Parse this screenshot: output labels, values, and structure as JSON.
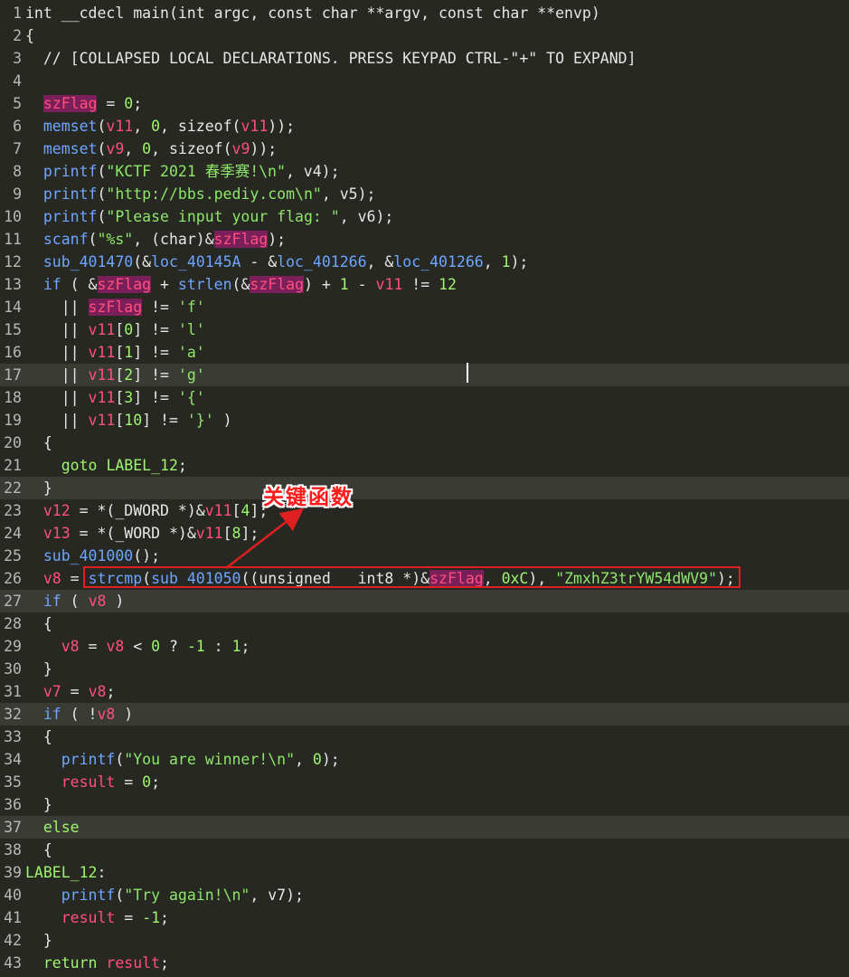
{
  "editor": {
    "lines": [
      {
        "n": "1",
        "tokens": [
          [
            "int __cdecl main(int argc, const char **argv, const char **envp)",
            ""
          ]
        ]
      },
      {
        "n": "2",
        "tokens": [
          [
            "{",
            ""
          ]
        ]
      },
      {
        "n": "3",
        "tokens": [
          [
            "  // [COLLAPSED LOCAL DECLARATIONS. PRESS KEYPAD CTRL-\"+\" TO EXPAND]",
            "cm"
          ]
        ]
      },
      {
        "n": "4",
        "tokens": []
      },
      {
        "n": "5",
        "tokens": [
          [
            "  ",
            ""
          ],
          [
            "szFlag",
            "hv"
          ],
          [
            " = ",
            ""
          ],
          [
            "0",
            "num"
          ],
          [
            ";",
            ""
          ]
        ]
      },
      {
        "n": "6",
        "tokens": [
          [
            "  ",
            ""
          ],
          [
            "memset",
            "fn"
          ],
          [
            "(",
            ""
          ],
          [
            "v11",
            "var"
          ],
          [
            ", ",
            ""
          ],
          [
            "0",
            "num"
          ],
          [
            ", sizeof(",
            ""
          ],
          [
            "v11",
            "var"
          ],
          [
            "));",
            ""
          ]
        ]
      },
      {
        "n": "7",
        "tokens": [
          [
            "  ",
            ""
          ],
          [
            "memset",
            "fn"
          ],
          [
            "(",
            ""
          ],
          [
            "v9",
            "var"
          ],
          [
            ", ",
            ""
          ],
          [
            "0",
            "num"
          ],
          [
            ", sizeof(",
            ""
          ],
          [
            "v9",
            "var"
          ],
          [
            "));",
            ""
          ]
        ]
      },
      {
        "n": "8",
        "tokens": [
          [
            "  ",
            ""
          ],
          [
            "printf",
            "fn"
          ],
          [
            "(",
            ""
          ],
          [
            "\"KCTF 2021 春季赛!\\n\"",
            "str"
          ],
          [
            ", v4);",
            ""
          ]
        ]
      },
      {
        "n": "9",
        "tokens": [
          [
            "  ",
            ""
          ],
          [
            "printf",
            "fn"
          ],
          [
            "(",
            ""
          ],
          [
            "\"http://bbs.pediy.com\\n\"",
            "str"
          ],
          [
            ", v5);",
            ""
          ]
        ]
      },
      {
        "n": "10",
        "tokens": [
          [
            "  ",
            ""
          ],
          [
            "printf",
            "fn"
          ],
          [
            "(",
            ""
          ],
          [
            "\"Please input your flag: \"",
            "str"
          ],
          [
            ", v6);",
            ""
          ]
        ]
      },
      {
        "n": "11",
        "tokens": [
          [
            "  ",
            ""
          ],
          [
            "scanf",
            "fn"
          ],
          [
            "(",
            ""
          ],
          [
            "\"%s\"",
            "str"
          ],
          [
            ", (char)&",
            ""
          ],
          [
            "szFlag",
            "hv"
          ],
          [
            ");",
            ""
          ]
        ]
      },
      {
        "n": "12",
        "tokens": [
          [
            "  ",
            ""
          ],
          [
            "sub_401470",
            "fn"
          ],
          [
            "(&",
            ""
          ],
          [
            "loc_40145A",
            "fn"
          ],
          [
            " - &",
            ""
          ],
          [
            "loc_401266",
            "fn"
          ],
          [
            ", &",
            ""
          ],
          [
            "loc_401266",
            "fn"
          ],
          [
            ", ",
            ""
          ],
          [
            "1",
            "num"
          ],
          [
            ");",
            ""
          ]
        ]
      },
      {
        "n": "13",
        "tokens": [
          [
            "  ",
            ""
          ],
          [
            "if",
            "fn"
          ],
          [
            " ( &",
            ""
          ],
          [
            "szFlag",
            "hv"
          ],
          [
            " + ",
            ""
          ],
          [
            "strlen",
            "fn"
          ],
          [
            "(&",
            ""
          ],
          [
            "szFlag",
            "hv"
          ],
          [
            ") + ",
            ""
          ],
          [
            "1",
            "num"
          ],
          [
            " - ",
            ""
          ],
          [
            "v11",
            "var"
          ],
          [
            " != ",
            ""
          ],
          [
            "12",
            "num"
          ]
        ]
      },
      {
        "n": "14",
        "tokens": [
          [
            "    || ",
            ""
          ],
          [
            "szFlag",
            "hv"
          ],
          [
            " != ",
            ""
          ],
          [
            "'f'",
            "str"
          ]
        ]
      },
      {
        "n": "15",
        "tokens": [
          [
            "    || ",
            ""
          ],
          [
            "v11",
            "var"
          ],
          [
            "[",
            ""
          ],
          [
            "0",
            "num"
          ],
          [
            "] != ",
            ""
          ],
          [
            "'l'",
            "str"
          ]
        ]
      },
      {
        "n": "16",
        "tokens": [
          [
            "    || ",
            ""
          ],
          [
            "v11",
            "var"
          ],
          [
            "[",
            ""
          ],
          [
            "1",
            "num"
          ],
          [
            "] != ",
            ""
          ],
          [
            "'a'",
            "str"
          ]
        ]
      },
      {
        "n": "17",
        "hl": true,
        "tokens": [
          [
            "    || ",
            ""
          ],
          [
            "v11",
            "var"
          ],
          [
            "[",
            ""
          ],
          [
            "2",
            "num"
          ],
          [
            "] != ",
            ""
          ],
          [
            "'g'",
            "str"
          ]
        ]
      },
      {
        "n": "18",
        "tokens": [
          [
            "    || ",
            ""
          ],
          [
            "v11",
            "var"
          ],
          [
            "[",
            ""
          ],
          [
            "3",
            "num"
          ],
          [
            "] != ",
            ""
          ],
          [
            "'{'",
            "str"
          ]
        ]
      },
      {
        "n": "19",
        "tokens": [
          [
            "    || ",
            ""
          ],
          [
            "v11",
            "var"
          ],
          [
            "[",
            ""
          ],
          [
            "10",
            "num"
          ],
          [
            "] != ",
            ""
          ],
          [
            "'}'",
            "str"
          ],
          [
            " )",
            ""
          ]
        ]
      },
      {
        "n": "20",
        "tokens": [
          [
            "  {",
            ""
          ]
        ]
      },
      {
        "n": "21",
        "tokens": [
          [
            "    ",
            ""
          ],
          [
            "goto",
            "num"
          ],
          [
            " ",
            ""
          ],
          [
            "LABEL_12",
            "num"
          ],
          [
            ";",
            ""
          ]
        ]
      },
      {
        "n": "22",
        "hl": true,
        "tokens": [
          [
            "  }",
            ""
          ]
        ]
      },
      {
        "n": "23",
        "tokens": [
          [
            "  ",
            ""
          ],
          [
            "v12",
            "var"
          ],
          [
            " = *(_DWORD *)&",
            ""
          ],
          [
            "v11",
            "var"
          ],
          [
            "[",
            ""
          ],
          [
            "4",
            "num"
          ],
          [
            "];",
            ""
          ]
        ]
      },
      {
        "n": "24",
        "tokens": [
          [
            "  ",
            ""
          ],
          [
            "v13",
            "var"
          ],
          [
            " = *(_WORD *)&",
            ""
          ],
          [
            "v11",
            "var"
          ],
          [
            "[",
            ""
          ],
          [
            "8",
            "num"
          ],
          [
            "];",
            ""
          ]
        ]
      },
      {
        "n": "25",
        "tokens": [
          [
            "  ",
            ""
          ],
          [
            "sub_401000",
            "fn"
          ],
          [
            "();",
            ""
          ]
        ]
      },
      {
        "n": "26",
        "tokens": [
          [
            "  ",
            ""
          ],
          [
            "v8",
            "var"
          ],
          [
            " = ",
            ""
          ],
          [
            "strcmp",
            "fn"
          ],
          [
            "(",
            ""
          ],
          [
            "sub_401050",
            "fn"
          ],
          [
            "((unsigned __int8 *)&",
            ""
          ],
          [
            "szFlag",
            "hv"
          ],
          [
            ", ",
            ""
          ],
          [
            "0xC",
            "num"
          ],
          [
            "), ",
            ""
          ],
          [
            "\"ZmxhZ3trYW54dWV9\"",
            "str"
          ],
          [
            ");",
            ""
          ]
        ]
      },
      {
        "n": "27",
        "hl": true,
        "tokens": [
          [
            "  ",
            ""
          ],
          [
            "if",
            "fn"
          ],
          [
            " ( ",
            ""
          ],
          [
            "v8",
            "var"
          ],
          [
            " )",
            ""
          ]
        ]
      },
      {
        "n": "28",
        "tokens": [
          [
            "  {",
            ""
          ]
        ]
      },
      {
        "n": "29",
        "tokens": [
          [
            "    ",
            ""
          ],
          [
            "v8",
            "var"
          ],
          [
            " = ",
            ""
          ],
          [
            "v8",
            "var"
          ],
          [
            " < ",
            ""
          ],
          [
            "0",
            "num"
          ],
          [
            " ? ",
            ""
          ],
          [
            "-1",
            "num"
          ],
          [
            " : ",
            ""
          ],
          [
            "1",
            "num"
          ],
          [
            ";",
            ""
          ]
        ]
      },
      {
        "n": "30",
        "tokens": [
          [
            "  }",
            ""
          ]
        ]
      },
      {
        "n": "31",
        "tokens": [
          [
            "  ",
            ""
          ],
          [
            "v7",
            "var"
          ],
          [
            " = ",
            ""
          ],
          [
            "v8",
            "var"
          ],
          [
            ";",
            ""
          ]
        ]
      },
      {
        "n": "32",
        "hl": true,
        "tokens": [
          [
            "  ",
            ""
          ],
          [
            "if",
            "fn"
          ],
          [
            " ( !",
            ""
          ],
          [
            "v8",
            "var"
          ],
          [
            " )",
            ""
          ]
        ]
      },
      {
        "n": "33",
        "tokens": [
          [
            "  {",
            ""
          ]
        ]
      },
      {
        "n": "34",
        "tokens": [
          [
            "    ",
            ""
          ],
          [
            "printf",
            "fn"
          ],
          [
            "(",
            ""
          ],
          [
            "\"You are winner!\\n\"",
            "str"
          ],
          [
            ", ",
            ""
          ],
          [
            "0",
            "num"
          ],
          [
            ");",
            ""
          ]
        ]
      },
      {
        "n": "35",
        "tokens": [
          [
            "    ",
            ""
          ],
          [
            "result",
            "var"
          ],
          [
            " = ",
            ""
          ],
          [
            "0",
            "num"
          ],
          [
            ";",
            ""
          ]
        ]
      },
      {
        "n": "36",
        "tokens": [
          [
            "  }",
            ""
          ]
        ]
      },
      {
        "n": "37",
        "hl": true,
        "tokens": [
          [
            "  ",
            ""
          ],
          [
            "else",
            "num"
          ]
        ]
      },
      {
        "n": "38",
        "tokens": [
          [
            "  {",
            ""
          ]
        ]
      },
      {
        "n": "39",
        "tokens": [
          [
            "LABEL_12",
            "num"
          ],
          [
            ":",
            ""
          ]
        ]
      },
      {
        "n": "40",
        "tokens": [
          [
            "    ",
            ""
          ],
          [
            "printf",
            "fn"
          ],
          [
            "(",
            ""
          ],
          [
            "\"Try again!\\n\"",
            "str"
          ],
          [
            ", v7);",
            ""
          ]
        ]
      },
      {
        "n": "41",
        "tokens": [
          [
            "    ",
            ""
          ],
          [
            "result",
            "var"
          ],
          [
            " = ",
            ""
          ],
          [
            "-1",
            "num"
          ],
          [
            ";",
            ""
          ]
        ]
      },
      {
        "n": "42",
        "tokens": [
          [
            "  }",
            ""
          ]
        ]
      },
      {
        "n": "43",
        "tokens": [
          [
            "  ",
            ""
          ],
          [
            "return",
            "num"
          ],
          [
            " ",
            ""
          ],
          [
            "result",
            "var"
          ],
          [
            ";",
            ""
          ]
        ]
      }
    ]
  },
  "annotation": {
    "label": "关键函数",
    "color": "#e02020"
  }
}
